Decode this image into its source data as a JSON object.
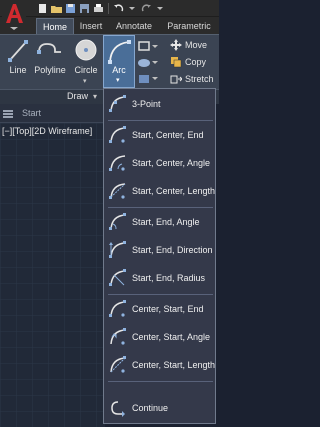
{
  "ribbon": {
    "tabs": [
      "Home",
      "Insert",
      "Annotate",
      "Parametric"
    ],
    "tools": {
      "line": "Line",
      "polyline": "Polyline",
      "circle": "Circle",
      "arc": "Arc"
    },
    "modify": {
      "move": "Move",
      "copy": "Copy",
      "stretch": "Stretch"
    },
    "panel_title": "Draw"
  },
  "file_tabs": {
    "start": "Start"
  },
  "viewport": {
    "label": "[−][Top][2D Wireframe]"
  },
  "arc_menu": {
    "items": [
      "3-Point",
      "Start, Center, End",
      "Start, Center, Angle",
      "Start, Center, Length",
      "Start, End, Angle",
      "Start, End, Direction",
      "Start, End, Radius",
      "Center, Start, End",
      "Center, Start, Angle",
      "Center, Start, Length",
      "Continue"
    ]
  },
  "colors": {
    "app_button": "#c0282d",
    "accent": "#4a6e98",
    "grid": "#2c3648"
  }
}
